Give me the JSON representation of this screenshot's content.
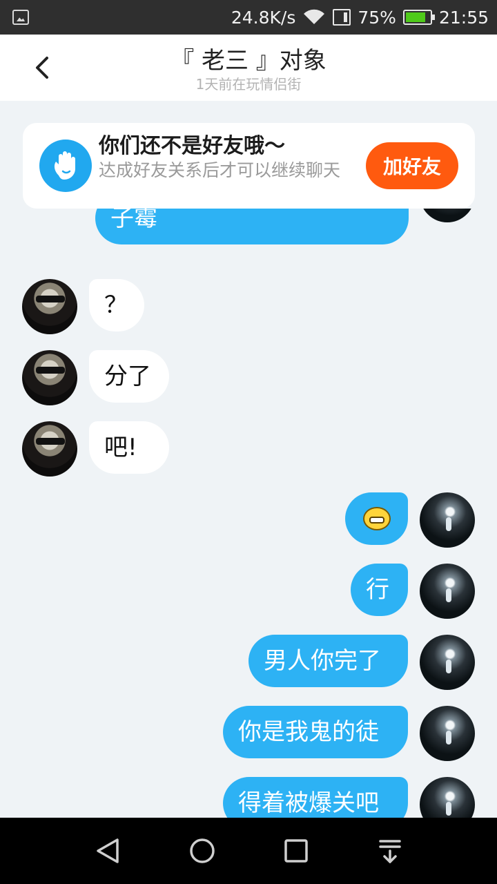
{
  "status_bar": {
    "net_speed": "24.8K/s",
    "battery_percent": "75%",
    "time": "21:55",
    "battery_level": 0.75,
    "icons": [
      "image-icon",
      "wifi-icon",
      "sim-icon",
      "battery-icon"
    ]
  },
  "header": {
    "title": "『 老三 』对象",
    "subtitle": "1天前在玩情侣街",
    "back_icon": "chevron-left-icon"
  },
  "banner": {
    "title": "你们还不是好友哦～",
    "description": "达成好友关系后才可以继续聊天",
    "button": "加好友",
    "icon": "hand-wave-icon",
    "accent": "#ff5a0f",
    "icon_color": "#21a8ef"
  },
  "messages": [
    {
      "side": "out",
      "text": "子霉",
      "partial": true
    },
    {
      "side": "in",
      "text": "？"
    },
    {
      "side": "in",
      "text": "分了"
    },
    {
      "side": "in",
      "text": "吧!"
    },
    {
      "side": "out",
      "text": "😁",
      "emoji": true
    },
    {
      "side": "out",
      "text": "行"
    },
    {
      "side": "out",
      "text": "男人你完了"
    },
    {
      "side": "out",
      "text": "你是我鬼的徒"
    },
    {
      "side": "out",
      "text": "得着被爆关吧",
      "partial": true
    }
  ],
  "colors": {
    "outgoing_bubble": "#2db2f4",
    "incoming_bubble": "#ffffff",
    "chat_background": "#eff3f6"
  },
  "navbar": {
    "icons": [
      "back-triangle-icon",
      "home-circle-icon",
      "recents-square-icon",
      "notification-pull-icon"
    ]
  }
}
